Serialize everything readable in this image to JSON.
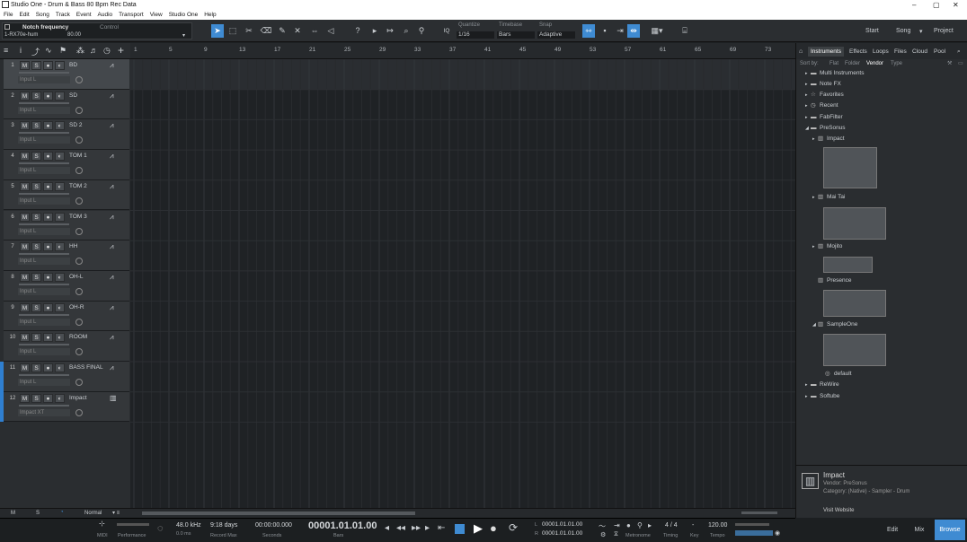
{
  "window": {
    "title": "Studio One - Drum & Bass 80 Bpm Rec Data",
    "minimize": "–",
    "maximize": "▢",
    "close": "✕"
  },
  "menu": [
    "File",
    "Edit",
    "Song",
    "Track",
    "Event",
    "Audio",
    "Transport",
    "View",
    "Studio One",
    "Help"
  ],
  "control": {
    "device": "Notch frequency",
    "section": "Control",
    "plugin": "1-RX70e-hum",
    "value": "80.00"
  },
  "toolbar": {
    "quantize_label": "Quantize",
    "quantize_value": "1/16",
    "timebase_label": "Timebase",
    "timebase_value": "Bars",
    "snap_label": "Snap",
    "snap_value": "Adaptive",
    "iq": "IQ",
    "start": "Start",
    "song": "Song",
    "project": "Project"
  },
  "tracks": [
    {
      "num": "1",
      "name": "BD",
      "input": "Input L",
      "icon": "waveform"
    },
    {
      "num": "2",
      "name": "SD",
      "input": "Input L",
      "icon": "waveform"
    },
    {
      "num": "3",
      "name": "SD 2",
      "input": "Input L",
      "icon": "waveform"
    },
    {
      "num": "4",
      "name": "TOM 1",
      "input": "Input L",
      "icon": "waveform"
    },
    {
      "num": "5",
      "name": "TOM 2",
      "input": "Input L",
      "icon": "waveform"
    },
    {
      "num": "6",
      "name": "TOM 3",
      "input": "Input L",
      "icon": "waveform"
    },
    {
      "num": "7",
      "name": "HH",
      "input": "Input L",
      "icon": "waveform"
    },
    {
      "num": "8",
      "name": "OH-L",
      "input": "Input L",
      "icon": "waveform"
    },
    {
      "num": "9",
      "name": "OH-R",
      "input": "Input L",
      "icon": "waveform"
    },
    {
      "num": "10",
      "name": "ROOM",
      "input": "Input L",
      "icon": "waveform"
    },
    {
      "num": "11",
      "name": "BASS FINAL",
      "input": "Input L",
      "icon": "waveform"
    },
    {
      "num": "12",
      "name": "Impact",
      "input": "Impact XT",
      "icon": "keyboard"
    }
  ],
  "track_buttons": {
    "mute": "M",
    "solo": "S",
    "record": "●",
    "monitor": "◐"
  },
  "ruler": [
    "1",
    "5",
    "9",
    "13",
    "17",
    "21",
    "25",
    "29",
    "33",
    "37",
    "41",
    "45",
    "49",
    "53",
    "57",
    "61",
    "65",
    "69",
    "73"
  ],
  "bottombar": {
    "m": "M",
    "s": "S",
    "mode": "Normal"
  },
  "transport": {
    "midi": "MIDI",
    "performance": "Performance",
    "sample_rate": "48.0 kHz",
    "latency": "0.0 ms",
    "record_days": "9:18 days",
    "record_max": "Record Max",
    "seconds_value": "00:00:00.000",
    "seconds_label": "Seconds",
    "bars_value": "00001.01.01.00",
    "bars_label": "Bars",
    "loop_l": "00001.01.01.00",
    "loop_r": "00001.01.01.00",
    "l": "L",
    "r": "R",
    "metronome": "Metronome",
    "timing": "Timing",
    "signature": "4 / 4",
    "key_value": "-",
    "key_label": "Key",
    "tempo_value": "120.00",
    "tempo_label": "Tempo"
  },
  "browser": {
    "tabs": [
      "Instruments",
      "Effects",
      "Loops",
      "Files",
      "Cloud",
      "Pool"
    ],
    "sort_by": "Sort by:",
    "sort_opts": [
      "Flat",
      "Folder",
      "Vendor",
      "Type"
    ],
    "tree": [
      {
        "label": "Multi Instruments",
        "level": 0
      },
      {
        "label": "Note FX",
        "level": 0
      },
      {
        "label": "Favorites",
        "level": 0
      },
      {
        "label": "Recent",
        "level": 0
      },
      {
        "label": "FabFilter",
        "level": 0
      },
      {
        "label": "PreSonus",
        "level": 0
      },
      {
        "label": "Impact",
        "level": 1
      },
      {
        "label": "Mai Tai",
        "level": 1
      },
      {
        "label": "Mojito",
        "level": 1
      },
      {
        "label": "Presence",
        "level": 1
      },
      {
        "label": "SampleOne",
        "level": 1
      },
      {
        "label": "default",
        "level": 2
      },
      {
        "label": "ReWire",
        "level": 0
      },
      {
        "label": "Softube",
        "level": 0
      }
    ],
    "info": {
      "name": "Impact",
      "vendor": "Vendor:    PreSonus",
      "category": "Category:  (Native) - Sampler - Drum",
      "website": "Visit Website"
    }
  },
  "modes": {
    "edit": "Edit",
    "mix": "Mix",
    "browse": "Browse"
  },
  "colors": {
    "accent": "#3f8bd2",
    "track_strip_blue": "#2f7fd0",
    "panel": "#2a2d30"
  }
}
